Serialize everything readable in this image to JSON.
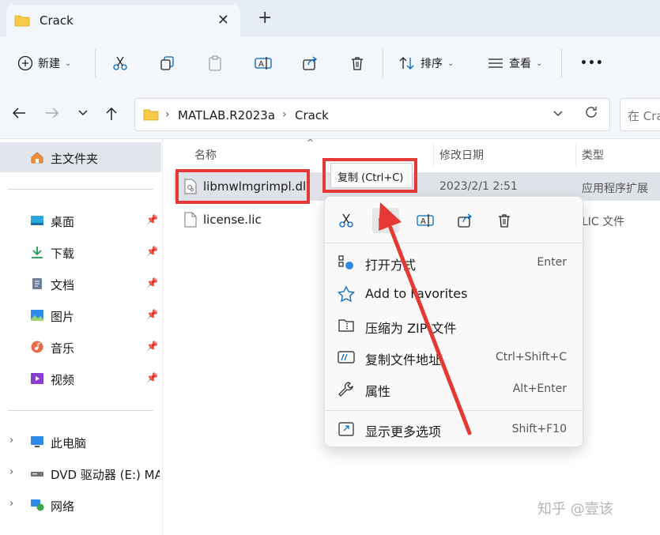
{
  "tab": {
    "title": "Crack",
    "close": "✕",
    "new_tab": "+"
  },
  "toolbar": {
    "new_label": "新建",
    "sort_label": "排序",
    "view_label": "查看",
    "more": "•••",
    "caret": "⌄"
  },
  "address": {
    "crumbs": [
      "MATLAB.R2023a",
      "Crack"
    ],
    "separator": "›",
    "search_placeholder": "在 Crack"
  },
  "sidebar": {
    "home": "主文件夹",
    "quick": [
      {
        "label": "桌面",
        "icon": "desktop-icon"
      },
      {
        "label": "下载",
        "icon": "download-icon"
      },
      {
        "label": "文档",
        "icon": "document-icon"
      },
      {
        "label": "图片",
        "icon": "picture-icon"
      },
      {
        "label": "音乐",
        "icon": "music-icon"
      },
      {
        "label": "视频",
        "icon": "video-icon"
      }
    ],
    "devices": [
      {
        "label": "此电脑",
        "icon": "computer-icon"
      },
      {
        "label": "DVD 驱动器 (E:) MATLAB",
        "icon": "dvd-drive-icon"
      },
      {
        "label": "网络",
        "icon": "network-icon"
      }
    ]
  },
  "columns": {
    "name": "名称",
    "date": "修改日期",
    "type": "类型"
  },
  "files": [
    {
      "name": "libmwlmgrimpl.dll",
      "date": "2023/2/1 2:51",
      "type": "应用程序扩展"
    },
    {
      "name": "license.lic",
      "date": "",
      "type": "LIC 文件"
    }
  ],
  "tooltip": {
    "text": "复制 (Ctrl+C)"
  },
  "context_menu": {
    "items": [
      {
        "label": "打开方式",
        "shortcut": "Enter"
      },
      {
        "label": "Add to Favorites",
        "shortcut": ""
      },
      {
        "label": "压缩为 ZIP 文件",
        "shortcut": ""
      },
      {
        "label": "复制文件地址",
        "shortcut": "Ctrl+Shift+C"
      },
      {
        "label": "属性",
        "shortcut": "Alt+Enter"
      },
      {
        "label": "显示更多选项",
        "shortcut": "Shift+F10"
      }
    ]
  },
  "watermark": "知乎 @壹该",
  "colors": {
    "highlight": "#e53935",
    "accent": "#0067c0",
    "folder": "#f7c948"
  }
}
